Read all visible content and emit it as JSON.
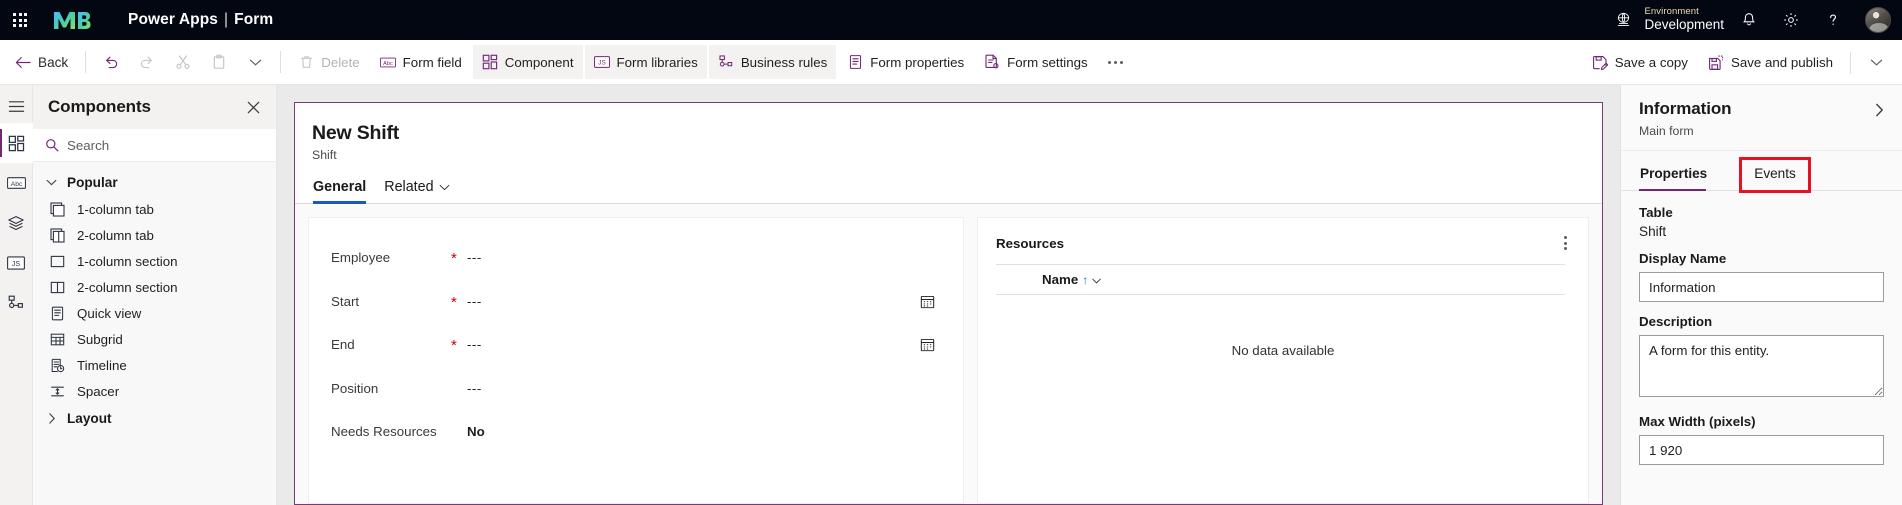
{
  "header": {
    "waffle_icon": "waffle-icon",
    "logo": "power-apps-logo",
    "product": "Power Apps",
    "separator": "|",
    "page": "Form",
    "environment_label": "Environment",
    "environment_name": "Development",
    "globe_icon": "globe-icon",
    "notifications_icon": "bell-icon",
    "settings_icon": "gear-icon",
    "help_icon": "help-icon",
    "avatar_icon": "user-avatar"
  },
  "commandbar": {
    "back": "Back",
    "undo_icon": "undo-icon",
    "redo_icon": "redo-icon",
    "cut_icon": "cut-icon",
    "paste_icon": "paste-icon",
    "more_caret_icon": "chevron-down-icon",
    "delete": "Delete",
    "form_field": "Form field",
    "component": "Component",
    "form_libraries": "Form libraries",
    "business_rules": "Business rules",
    "form_properties": "Form properties",
    "form_settings": "Form settings",
    "overflow": "…",
    "save_a_copy": "Save a copy",
    "save_and_publish": "Save and publish",
    "right_caret_icon": "chevron-down-icon"
  },
  "rail": {
    "items": [
      {
        "name": "hamburger-menu-icon"
      },
      {
        "name": "components-icon",
        "active": true
      },
      {
        "name": "form-field-abc-icon"
      },
      {
        "name": "layers-icon"
      },
      {
        "name": "javascript-libraries-icon"
      },
      {
        "name": "business-rules-icon"
      }
    ]
  },
  "components_panel": {
    "title": "Components",
    "close_icon": "close-icon",
    "search_placeholder": "Search",
    "search_value": "",
    "groups": [
      {
        "label": "Popular",
        "expanded": true,
        "items": [
          {
            "label": "1-column tab",
            "icon": "one-column-tab-icon"
          },
          {
            "label": "2-column tab",
            "icon": "two-column-tab-icon"
          },
          {
            "label": "1-column section",
            "icon": "one-column-section-icon"
          },
          {
            "label": "2-column section",
            "icon": "two-column-section-icon"
          },
          {
            "label": "Quick view",
            "icon": "quick-view-icon"
          },
          {
            "label": "Subgrid",
            "icon": "subgrid-icon"
          },
          {
            "label": "Timeline",
            "icon": "timeline-icon"
          },
          {
            "label": "Spacer",
            "icon": "spacer-icon"
          }
        ]
      },
      {
        "label": "Layout",
        "expanded": false,
        "items": []
      }
    ]
  },
  "canvas": {
    "form_title": "New Shift",
    "form_subtitle": "Shift",
    "tabs": [
      {
        "label": "General",
        "active": true,
        "caret": false
      },
      {
        "label": "Related",
        "active": false,
        "caret": true
      }
    ],
    "fields": [
      {
        "label": "Employee",
        "required": true,
        "value": "---",
        "calendar": false
      },
      {
        "label": "Start",
        "required": true,
        "value": "---",
        "calendar": true
      },
      {
        "label": "End",
        "required": true,
        "value": "---",
        "calendar": true
      },
      {
        "label": "Position",
        "required": false,
        "value": "---",
        "calendar": false
      },
      {
        "label": "Needs Resources",
        "required": false,
        "value": "No",
        "calendar": false,
        "bold": true
      }
    ],
    "subgrid": {
      "title": "Resources",
      "more_icon": "more-vertical-icon",
      "columns": [
        {
          "label": "Name",
          "sort": "↑",
          "caret_icon": "chevron-down-icon"
        }
      ],
      "empty_text": "No data available"
    }
  },
  "properties_panel": {
    "title": "Information",
    "subtitle": "Main form",
    "collapse_icon": "chevron-right-icon",
    "tabs": [
      {
        "label": "Properties",
        "active": true,
        "highlighted": false
      },
      {
        "label": "Events",
        "active": false,
        "highlighted": true
      }
    ],
    "fields": {
      "table_label": "Table",
      "table_value": "Shift",
      "display_name_label": "Display Name",
      "display_name_value": "Information",
      "description_label": "Description",
      "description_value": "A form for this entity.",
      "max_width_label": "Max Width (pixels)",
      "max_width_value": "1 920"
    }
  },
  "colors": {
    "header_bg": "#030712",
    "accent_purple": "#742774",
    "tab_underline_blue": "#185abd",
    "highlight_red": "#e81123",
    "required_red": "#cc0000"
  }
}
